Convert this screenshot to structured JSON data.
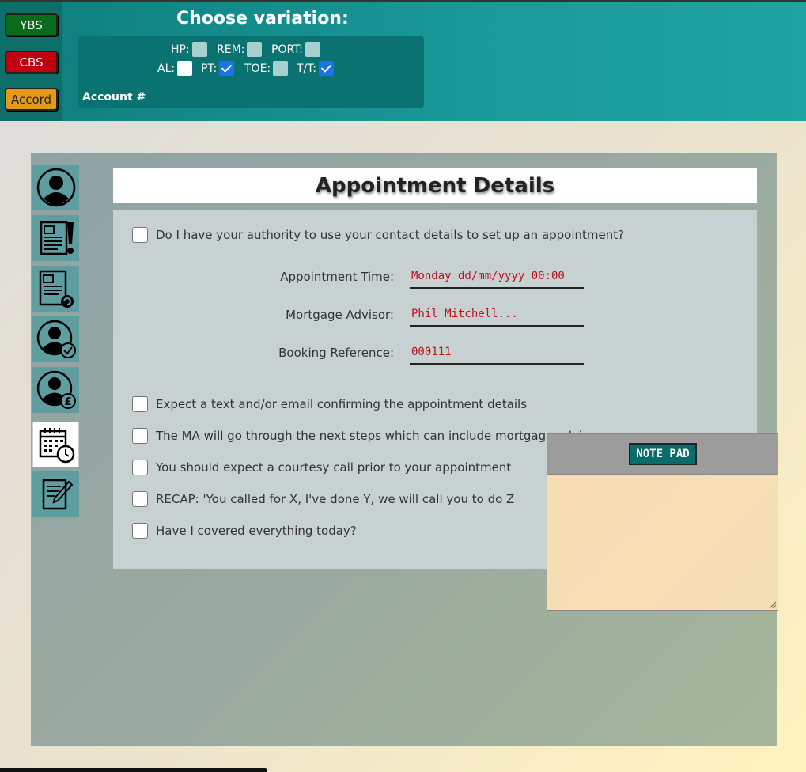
{
  "header": {
    "bank_buttons": [
      {
        "label": "YBS",
        "color": "#0a6b1d"
      },
      {
        "label": "CBS",
        "color": "#c00010"
      },
      {
        "label": "Accord",
        "color": "#e39a19"
      }
    ],
    "choose_title": "Choose variation:",
    "variations": [
      {
        "label": "HP:",
        "checked": false
      },
      {
        "label": "REM:",
        "checked": false
      },
      {
        "label": "PORT:",
        "checked": false
      },
      {
        "label": "AL:",
        "checked": false
      },
      {
        "label": "PT:",
        "checked": true
      },
      {
        "label": "TOE:",
        "checked": false
      },
      {
        "label": "T/T:",
        "checked": true
      }
    ],
    "account_label": "Account #"
  },
  "sidebar": {
    "items": [
      {
        "icon": "customer-profile-icon",
        "active": false
      },
      {
        "icon": "document-alert-icon",
        "active": false
      },
      {
        "icon": "document-refresh-icon",
        "active": false
      },
      {
        "icon": "person-check-icon",
        "active": false
      },
      {
        "icon": "person-pound-icon",
        "active": false
      },
      {
        "icon": "calendar-clock-icon",
        "active": true
      },
      {
        "icon": "notes-pen-icon",
        "active": false
      }
    ]
  },
  "main": {
    "title": "Appointment Details",
    "authority_question": "Do I have your authority to use your contact details to set up an appointment?",
    "fields": [
      {
        "label": "Appointment Time:",
        "value": "Monday dd/mm/yyyy 00:00"
      },
      {
        "label": "Mortgage Advisor:",
        "value": "Phil Mitchell..."
      },
      {
        "label": "Booking Reference:",
        "value": "000111"
      }
    ],
    "checklist": [
      "Expect a text and/or email confirming the appointment details",
      "The MA will go through the next steps which can include mortgage advice",
      "You should expect a courtesy call prior to your appointment",
      "RECAP: 'You called for X, I've done Y, we will call you to do Z",
      "Have I covered everything today?"
    ]
  },
  "notepad": {
    "button_label": "NOTE PAD",
    "text": ""
  },
  "colors": {
    "header_teal": "#1a9999",
    "field_value_red": "#c0101a",
    "notepad_bg": "#f6ddb5"
  }
}
